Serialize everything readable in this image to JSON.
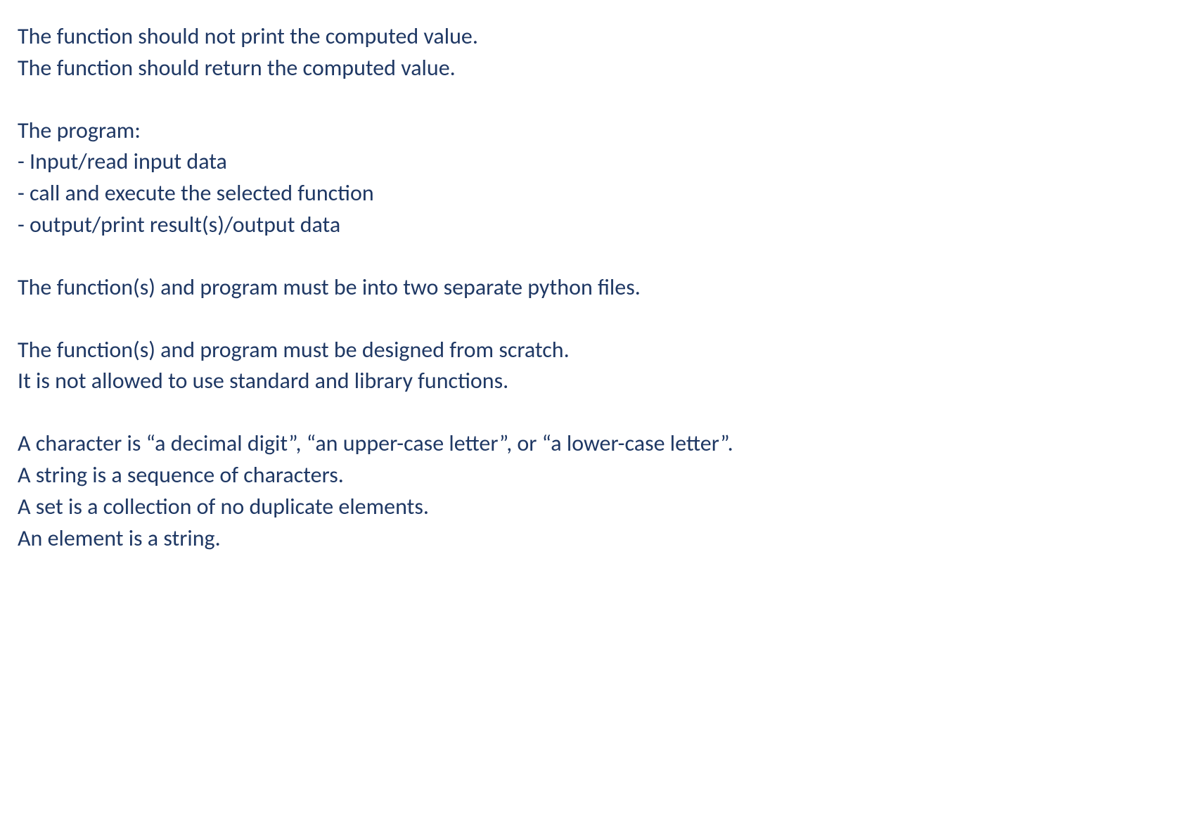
{
  "paragraphs": [
    {
      "lines": [
        "The function should not print the computed value.",
        "The function should return the computed value."
      ]
    },
    {
      "lines": [
        "The program:",
        "- Input/read input data",
        "- call and execute the selected function",
        "- output/print result(s)/output data"
      ]
    },
    {
      "lines": [
        "The function(s) and program must be into two separate python files."
      ]
    },
    {
      "lines": [
        "The function(s) and program must be designed from scratch.",
        "It is not allowed to use standard and library functions."
      ]
    },
    {
      "lines": [
        "A character is “a decimal digit”, “an upper-case letter”, or “a lower-case letter”.",
        "A string is a sequence of characters.",
        "A set is a collection of no duplicate elements.",
        "An element is a string."
      ]
    }
  ]
}
